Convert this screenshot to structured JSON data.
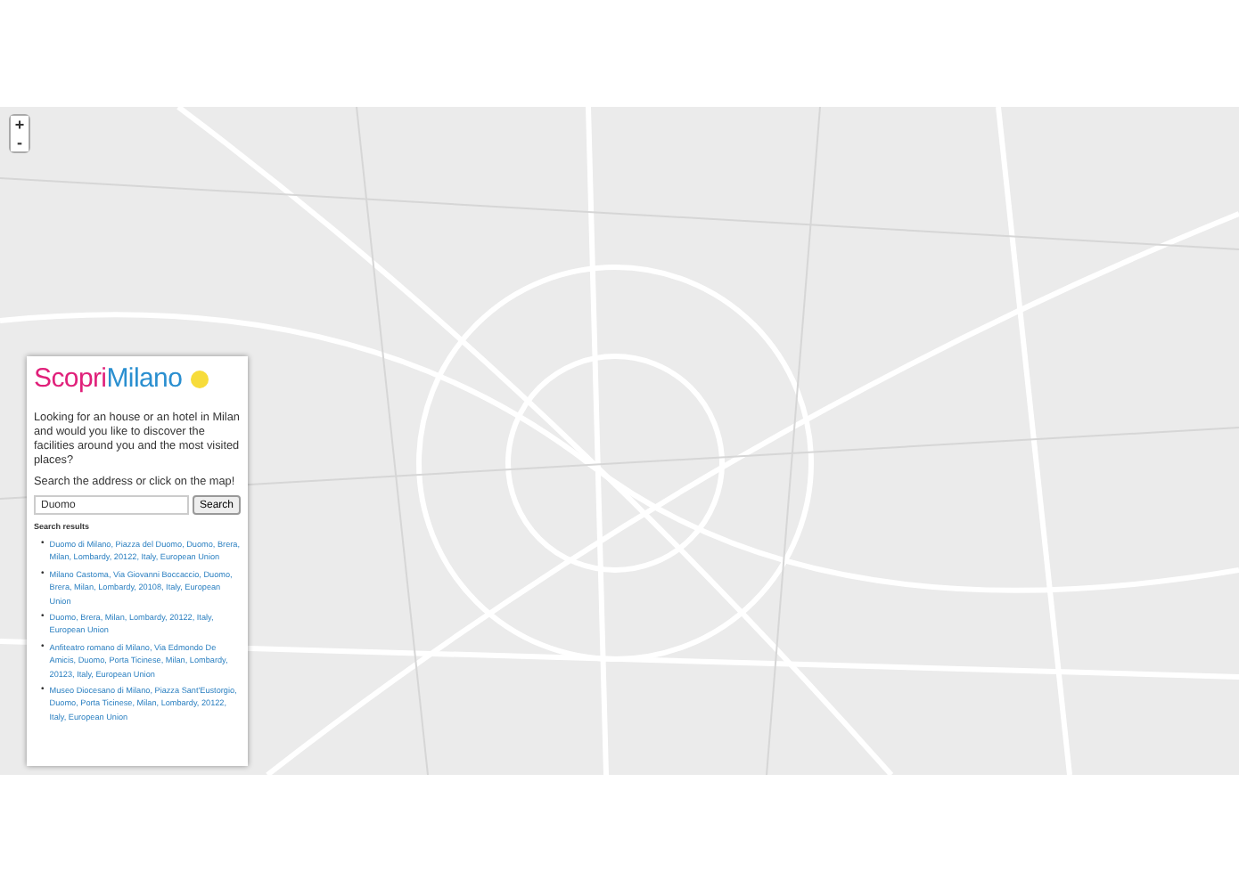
{
  "zoom_controls": {
    "zoom_in": "+",
    "zoom_out": "-"
  },
  "panel": {
    "logo": {
      "first": "Scopri",
      "second": "Milano"
    },
    "intro": "Looking for an house or an hotel in Milan and would you like to discover the facilities around you and the most visited places?",
    "prompt": "Search the address or click on the map!",
    "search": {
      "value": "Duomo",
      "button": "Search"
    },
    "results_title": "Search results",
    "results": [
      {
        "bullet": "•",
        "text": "Duomo di Milano, Piazza del Duomo, Duomo, Brera, Milan, Lombardy, 20122, Italy, European Union"
      },
      {
        "bullet": "•",
        "text": "Milano Castoma, Via Giovanni Boccaccio, Duomo, Brera, Milan, Lombardy, 20108, Italy, European Union"
      },
      {
        "bullet": "•",
        "text": "Duomo, Brera, Milan, Lombardy, 20122, Italy, European Union"
      },
      {
        "bullet": "•",
        "text": "Anfiteatro romano di Milano, Via Edmondo De Amicis, Duomo, Porta Ticinese, Milan, Lombardy, 20123, Italy, European Union"
      },
      {
        "bullet": "•",
        "text": "Museo Diocesano di Milano, Piazza Sant'Eustorgio, Duomo, Porta Ticinese, Milan, Lombardy, 20122, Italy, European Union"
      }
    ]
  }
}
